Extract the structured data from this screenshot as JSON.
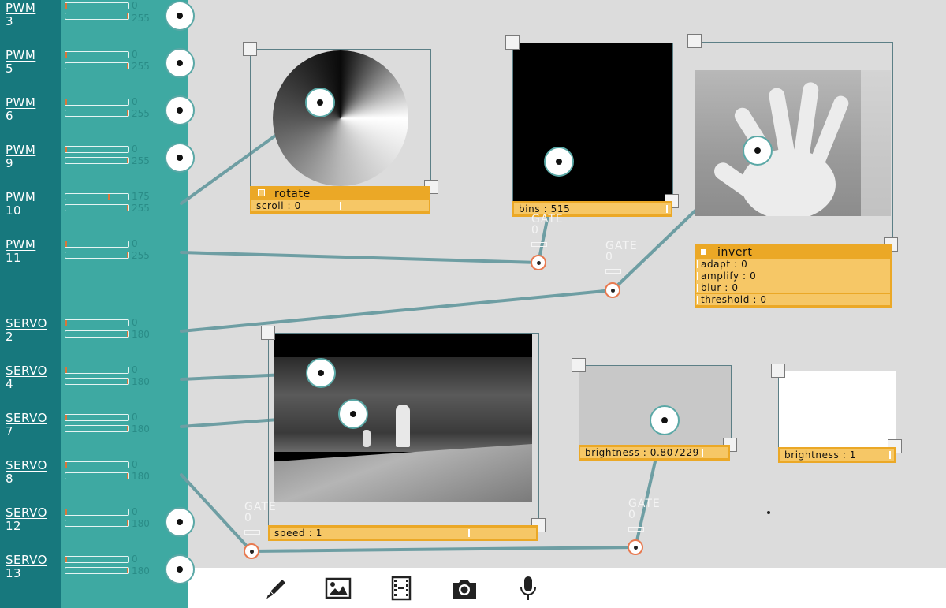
{
  "channels": [
    {
      "type": "PWM",
      "num": "3",
      "min": "0",
      "max": "255",
      "port": true
    },
    {
      "type": "PWM",
      "num": "5",
      "min": "0",
      "max": "255",
      "port": true
    },
    {
      "type": "PWM",
      "num": "6",
      "min": "0",
      "max": "255",
      "port": true
    },
    {
      "type": "PWM",
      "num": "9",
      "min": "0",
      "max": "255",
      "port": true
    },
    {
      "type": "PWM",
      "num": "10",
      "min": "175",
      "max": "255",
      "port": false
    },
    {
      "type": "PWM",
      "num": "11",
      "min": "0",
      "max": "255",
      "port": false
    },
    {
      "type": "SERVO",
      "num": "2",
      "min": "0",
      "max": "180",
      "port": false
    },
    {
      "type": "SERVO",
      "num": "4",
      "min": "0",
      "max": "180",
      "port": false
    },
    {
      "type": "SERVO",
      "num": "7",
      "min": "0",
      "max": "180",
      "port": false
    },
    {
      "type": "SERVO",
      "num": "8",
      "min": "0",
      "max": "180",
      "port": false
    },
    {
      "type": "SERVO",
      "num": "12",
      "min": "0",
      "max": "180",
      "port": true
    },
    {
      "type": "SERVO",
      "num": "13",
      "min": "0",
      "max": "180",
      "port": true
    }
  ],
  "nodes": {
    "rotate": {
      "title": "rotate",
      "scroll_label": "scroll : 0"
    },
    "histogram": {
      "bins_label": "bins : 515"
    },
    "camera": {
      "title": "invert",
      "adapt": "adapt : 0",
      "amplify": "amplify : 0",
      "blur": "blur : 0",
      "threshold": "threshold : 0"
    },
    "video": {
      "speed_label": "speed : 1"
    },
    "gray": {
      "brightness_label": "brightness : 0.807229"
    },
    "white": {
      "brightness_label": "brightness : 1"
    }
  },
  "gates": {
    "label": "GATE",
    "g1": {
      "value": "0"
    },
    "g2": {
      "value": "0"
    },
    "g3": {
      "value": "0"
    },
    "g4": {
      "value": "0"
    }
  },
  "toolbar": {
    "icons": [
      "pencil-icon",
      "image-icon",
      "film-icon",
      "camera-icon",
      "microphone-icon"
    ]
  },
  "colors": {
    "sidebar_dark": "#17787d",
    "sidebar_light": "#3ea9a2",
    "panel": "#eba826",
    "wire": "#6e9ea3",
    "port_ring": "#e8794f"
  }
}
